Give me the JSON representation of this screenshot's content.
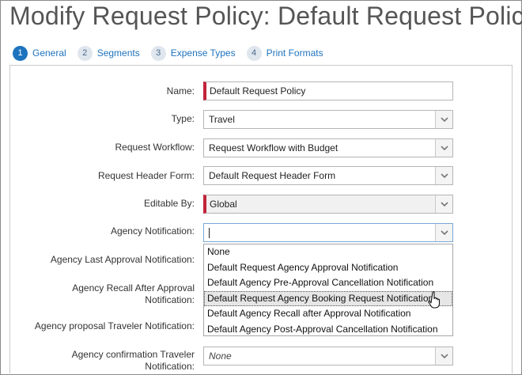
{
  "page": {
    "title": "Modify Request Policy: Default Request Policy"
  },
  "steps": [
    {
      "num": "1",
      "label": "General",
      "active": true
    },
    {
      "num": "2",
      "label": "Segments",
      "active": false
    },
    {
      "num": "3",
      "label": "Expense Types",
      "active": false
    },
    {
      "num": "4",
      "label": "Print Formats",
      "active": false
    }
  ],
  "form": {
    "name_label": "Name:",
    "name_value": "Default Request Policy",
    "type_label": "Type:",
    "type_value": "Travel",
    "workflow_label": "Request Workflow:",
    "workflow_value": "Request Workflow with Budget",
    "header_form_label": "Request Header Form:",
    "header_form_value": "Default Request Header Form",
    "editable_by_label": "Editable By:",
    "editable_by_value": "Global",
    "agency_notification_label": "Agency Notification:",
    "agency_notification_value": "",
    "agency_last_approval_label": "Agency Last Approval Notification:",
    "agency_recall_label_1": "Agency Recall After Approval",
    "agency_recall_label_2": "Notification:",
    "agency_proposal_label": "Agency proposal Traveler Notification:",
    "agency_confirmation_label_1": "Agency confirmation Traveler",
    "agency_confirmation_label_2": "Notification:",
    "agency_confirmation_value": "None"
  },
  "dropdown": {
    "options": [
      "None",
      "Default Request Agency Approval Notification",
      "Default Agency Pre-Approval Cancellation Notification",
      "Default Request Agency Booking Request Notification",
      "Default Agency Recall after Approval Notification",
      "Default Agency Post-Approval Cancellation Notification"
    ],
    "hovered_index": 3
  },
  "colors": {
    "accent": "#1e73be",
    "required": "#c0243a"
  },
  "icons": {
    "select": "chevron-down-icon",
    "cursor": "hand-pointer-icon"
  }
}
